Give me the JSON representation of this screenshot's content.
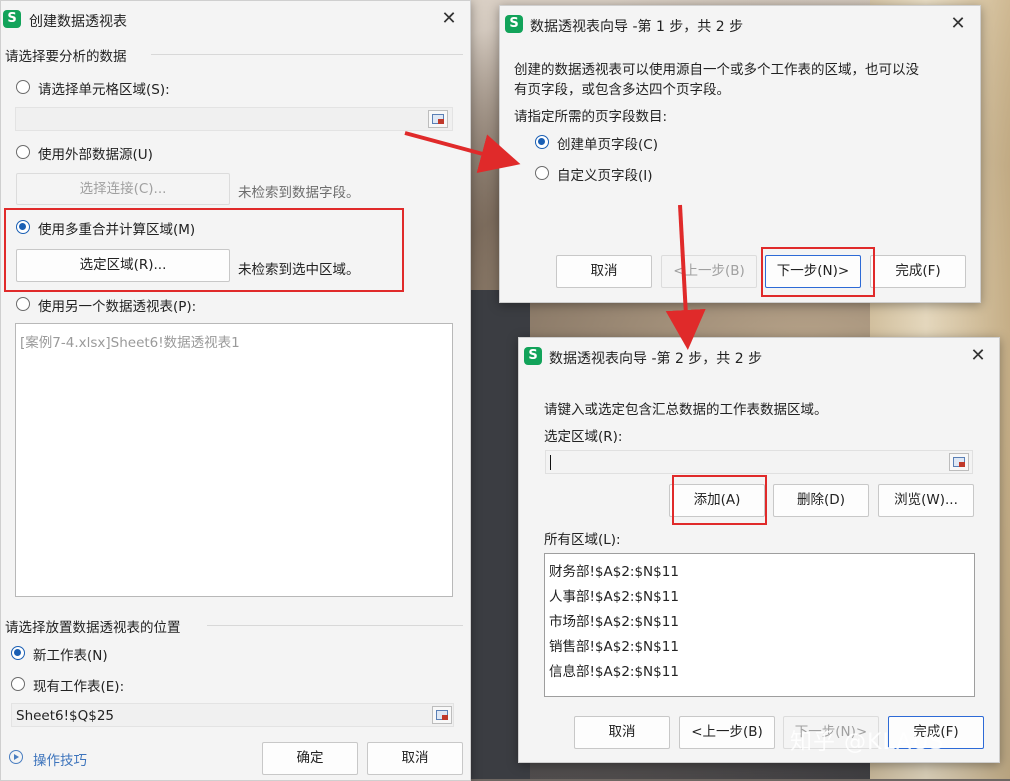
{
  "dialog_create": {
    "title": "创建数据透视表",
    "section_data": "请选择要分析的数据",
    "opt_cell_range": "请选择单元格区域(S):",
    "opt_external": "使用外部数据源(U)",
    "btn_select_connection": "选择连接(C)...",
    "no_data_field": "未检索到数据字段。",
    "opt_multi_consolidate": "使用多重合并计算区域(M)",
    "btn_select_region": "选定区域(R)...",
    "no_selected_region": "未检索到选中区域。",
    "opt_another_pivot": "使用另一个数据透视表(P):",
    "pivot_list_item": "[案例7-4.xlsx]Sheet6!数据透视表1",
    "section_location": "请选择放置数据透视表的位置",
    "opt_new_sheet": "新工作表(N)",
    "opt_existing_sheet": "现有工作表(E):",
    "location_value": "Sheet6!$Q$25",
    "tips_link": "操作技巧",
    "btn_ok": "确定",
    "btn_cancel": "取消"
  },
  "dialog_step1": {
    "title": "数据透视表向导 -第 1 步，共 2 步",
    "desc_line1": "创建的数据透视表可以使用源自一个或多个工作表的区域，也可以没",
    "desc_line2": "有页字段，或包含多达四个页字段。",
    "prompt": "请指定所需的页字段数目:",
    "opt_single": "创建单页字段(C)",
    "opt_custom": "自定义页字段(I)",
    "btn_cancel": "取消",
    "btn_prev": "<上一步(B)",
    "btn_next": "下一步(N)>",
    "btn_finish": "完成(F)"
  },
  "dialog_step2": {
    "title": "数据透视表向导 -第 2 步，共 2 步",
    "instruction": "请键入或选定包含汇总数据的工作表数据区域。",
    "range_label": "选定区域(R):",
    "range_value": "",
    "btn_add": "添加(A)",
    "btn_delete": "删除(D)",
    "btn_browse": "浏览(W)...",
    "all_ranges_label": "所有区域(L):",
    "ranges": [
      "财务部!$A$2:$N$11",
      "人事部!$A$2:$N$11",
      "市场部!$A$2:$N$11",
      "销售部!$A$2:$N$11",
      "信息部!$A$2:$N$11"
    ],
    "btn_cancel": "取消",
    "btn_prev": "<上一步(B)",
    "btn_next": "下一步(N)>",
    "btn_finish": "完成(F)"
  },
  "app_icon_letter": "S",
  "watermark": "知乎 @KLAUS",
  "colors": {
    "accent": "#1a5fb4",
    "highlight": "#e02a2a",
    "app_icon": "#12a35a"
  }
}
